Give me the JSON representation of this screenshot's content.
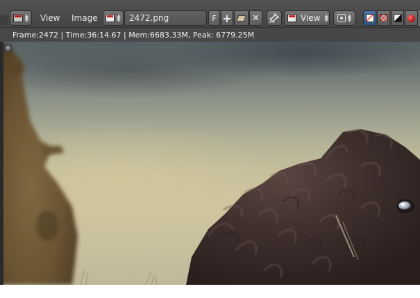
{
  "header": {
    "editor_type_icon": "image-editor-icon",
    "menus": [
      "View",
      "Image"
    ],
    "image_name": "2472.png",
    "fake_user_label": "F",
    "new_image_icon": "plus-icon",
    "pack_icon": "package-icon",
    "unlink_icon": "close-icon",
    "pin_icon": "pin-icon",
    "view_mode_label": "View",
    "pivot_icon": "pivot-icon",
    "channel_icons": [
      "color-channel-icon",
      "alpha-channel-icon",
      "z-buffer-icon"
    ],
    "record_icon": "record-icon"
  },
  "status": {
    "render_info": "Frame:2472 | Time:36:14.67 | Mem:6683.33M, Peak: 6779.25M"
  },
  "colors": {
    "header_bg": "#4b4b4b",
    "active_channel": "#3d6596",
    "sky": "#c6bf9c",
    "fur": "#3a2c29"
  }
}
